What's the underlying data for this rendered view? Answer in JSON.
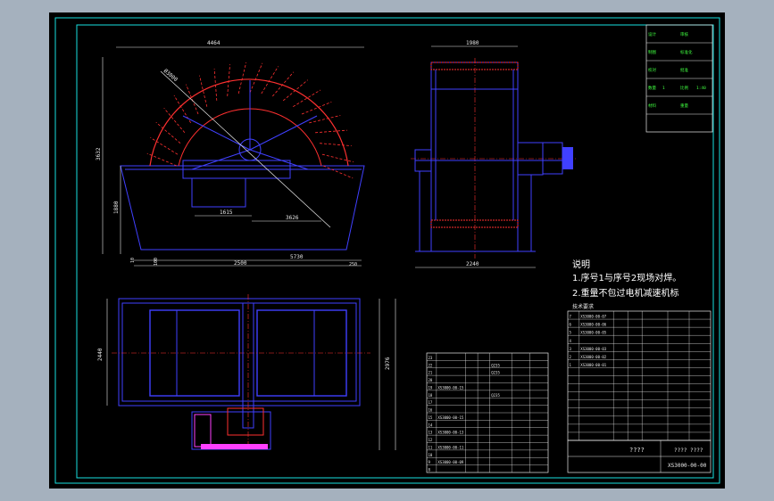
{
  "colors": {
    "background_outer": "#a5b1be",
    "background_inner": "#000000",
    "frame": "#18e0e0",
    "part_outline": "#4040ff",
    "impeller": "#ff3030",
    "dimension": "#e8e8e8",
    "table_line": "#ffffff",
    "label_green": "#40ff40",
    "motor": "#ff40ff"
  },
  "dimensions": {
    "front_total_width": "4464",
    "front_wheel_diameter": "Ø3000",
    "front_height": "3632",
    "front_tank_height": "1880",
    "front_shaft_offset": "1615",
    "front_slope": "3626",
    "front_base_left": "2500",
    "front_base_right": "5730",
    "front_base_small_left": "10",
    "front_base_small": "100",
    "front_base_end": "250",
    "side_top_width": "1980",
    "side_bottom_width": "2240",
    "plan_width": "2440",
    "plan_right": "2976"
  },
  "title_block": {
    "rows": [
      [
        "设计",
        "",
        "审核",
        ""
      ],
      [
        "制图",
        "",
        "标准化",
        ""
      ],
      [
        "校对",
        "",
        "批准",
        ""
      ],
      [
        "数量",
        "1",
        "比例",
        "1:40"
      ],
      [
        "材料",
        "",
        "重量",
        ""
      ],
      [
        "",
        "",
        "",
        ""
      ]
    ]
  },
  "notes": {
    "heading": "说明",
    "line1": "1.序号1与序号2现场对焊。",
    "line2": "2.重量不包过电机减速机标",
    "tech_label": "技术要求"
  },
  "bom_left": {
    "rows": [
      [
        "23",
        "",
        "",
        "",
        "",
        "",
        ""
      ],
      [
        "22",
        "",
        "",
        "",
        "Q235",
        "",
        "",
        ""
      ],
      [
        "21",
        "",
        "",
        "",
        "Q235",
        "",
        ""
      ],
      [
        "20",
        "",
        "",
        "",
        "",
        "",
        ""
      ],
      [
        "19",
        "XS3000-00-15",
        "",
        "",
        "",
        "",
        ""
      ],
      [
        "18",
        "",
        "",
        "",
        "Q235",
        "",
        ""
      ],
      [
        "17",
        "",
        "",
        "",
        "",
        "",
        ""
      ],
      [
        "16",
        "",
        "",
        "",
        "",
        "",
        ""
      ],
      [
        "15",
        "XS3000-00-15",
        "",
        "",
        "",
        "",
        ""
      ],
      [
        "14",
        "",
        "",
        "",
        "",
        "",
        ""
      ],
      [
        "13",
        "XS3000-00-13",
        "",
        "",
        "",
        "",
        ""
      ],
      [
        "12",
        "",
        "",
        "",
        "",
        "",
        ""
      ],
      [
        "11",
        "XS3000-00-11",
        "",
        "",
        "",
        "",
        ""
      ],
      [
        "10",
        "",
        "",
        "",
        "",
        "",
        ""
      ],
      [
        "9",
        "XS3000-00-09",
        "",
        "",
        "",
        "",
        ""
      ],
      [
        "8",
        "",
        "",
        "",
        "",
        "",
        ""
      ]
    ]
  },
  "bom_right": {
    "rows": [
      [
        "7",
        "XS3000-00-07",
        "",
        "",
        "",
        "",
        ""
      ],
      [
        "6",
        "XS3000-00-06",
        "",
        "",
        "",
        "",
        ""
      ],
      [
        "5",
        "XS3000-00-05",
        "",
        "",
        "",
        "",
        ""
      ],
      [
        "4",
        "",
        "",
        "",
        "",
        "",
        ""
      ],
      [
        "3",
        "XS3000-00-03",
        "",
        "",
        "",
        "",
        ""
      ],
      [
        "2",
        "XS3000-00-02",
        "",
        "",
        "",
        "",
        ""
      ],
      [
        "1",
        "XS3000-00-01",
        "",
        "",
        "",
        "",
        ""
      ],
      [
        "",
        "",
        "",
        "",
        "",
        "",
        ""
      ],
      [
        "",
        "",
        "",
        "",
        "",
        "",
        ""
      ],
      [
        "",
        "",
        "",
        "",
        "",
        "",
        ""
      ],
      [
        "",
        "",
        "",
        "",
        "",
        "",
        ""
      ],
      [
        "",
        "",
        "",
        "",
        "",
        "",
        ""
      ],
      [
        "",
        "",
        "",
        "",
        "",
        "",
        ""
      ],
      [
        "",
        "",
        "",
        "",
        "",
        "",
        ""
      ],
      [
        "",
        "",
        "",
        "",
        "",
        "",
        ""
      ],
      [
        "",
        "",
        "",
        "",
        "",
        "",
        ""
      ]
    ]
  },
  "drawing_number": "XS3000-00-00",
  "drawing_name": "????",
  "scale_note": "????  ????"
}
